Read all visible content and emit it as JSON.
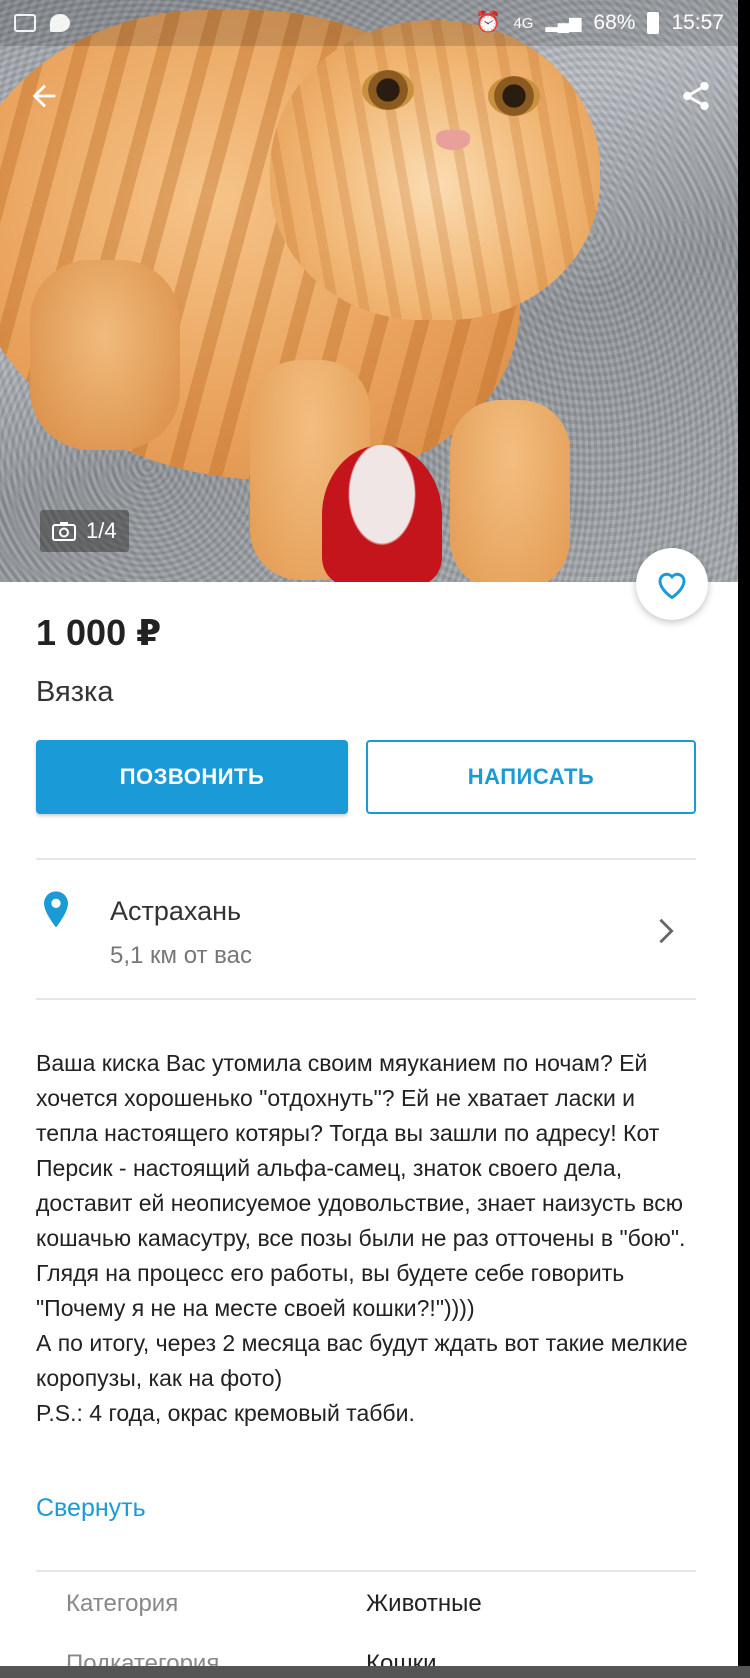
{
  "status_bar": {
    "network": "4G",
    "battery": "68%",
    "time": "15:57"
  },
  "photo": {
    "counter": "1/4"
  },
  "listing": {
    "price": "1 000 ₽",
    "title": "Вязка"
  },
  "actions": {
    "call_label": "ПОЗВОНИТЬ",
    "write_label": "НАПИСАТЬ"
  },
  "location": {
    "city": "Астрахань",
    "distance": "5,1 км от вас"
  },
  "description": {
    "text": "Ваша киска Вас утомила своим мяуканием по ночам? Ей хочется хорошенько \"отдохнуть\"? Ей не хватает ласки и тепла настоящего котяры? Тогда вы зашли по адресу! Кот Персик - настоящий альфа-самец, знаток своего дела, доставит ей неописуемое удовольствие, знает наизусть всю кошачью камасутру, все позы были не раз отточены в \"бою\". Глядя на процесс его работы, вы будете себе говорить \"Почему я не на месте своей кошки?!\"))))\nА по итогу, через 2 месяца вас будут ждать вот такие мелкие коропузы, как на фото)\nP.S.: 4 года, окрас кремовый табби.",
    "collapse_label": "Свернуть"
  },
  "params": [
    {
      "label": "Категория",
      "value": "Животные"
    },
    {
      "label": "Подкатегория",
      "value": "Кошки"
    }
  ],
  "colors": {
    "accent": "#1a9ad6",
    "price_text": "#222222",
    "muted_text": "#888888"
  },
  "icons": {
    "back": "arrow-left-icon",
    "share": "share-icon",
    "favorite": "heart-outline-icon",
    "camera": "camera-icon",
    "location": "location-pin-icon",
    "chevron": "chevron-right-icon"
  }
}
